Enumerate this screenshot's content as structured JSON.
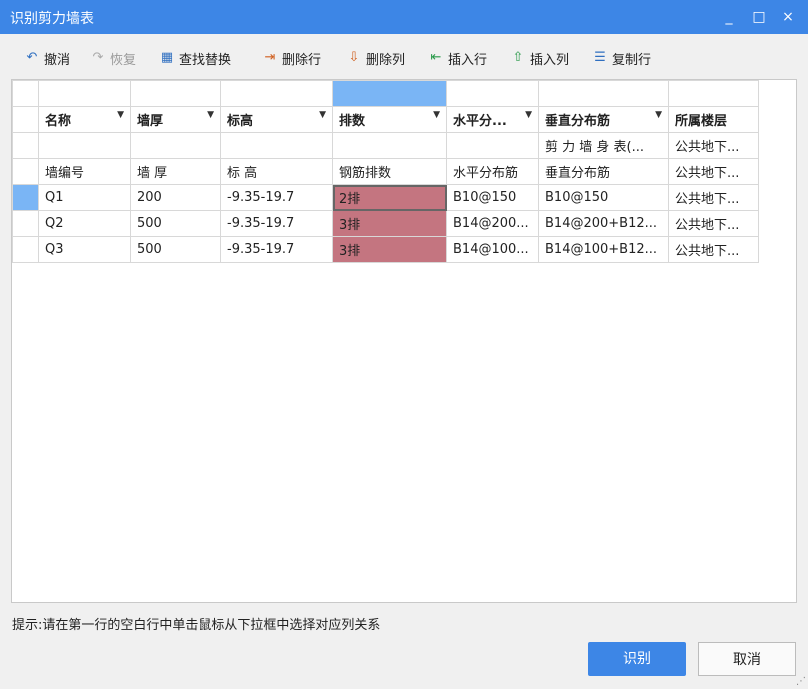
{
  "window": {
    "title": "识别剪力墙表",
    "minimize": "_",
    "maximize": "□",
    "close": "×"
  },
  "toolbar": {
    "undo": "撤消",
    "redo": "恢复",
    "find_replace": "查找替换",
    "delete_row": "删除行",
    "delete_col": "删除列",
    "insert_row": "插入行",
    "insert_col": "插入列",
    "copy_row": "复制行"
  },
  "grid": {
    "headers": [
      "名称",
      "墙厚",
      "标高",
      "排数",
      "水平分...",
      "垂直分布筋",
      "所属楼层"
    ],
    "header_has_dropdown": [
      true,
      true,
      true,
      true,
      true,
      true,
      false
    ],
    "rows": [
      [
        "",
        "",
        "",
        "",
        "",
        "剪 力 墙 身 表(...",
        "公共地下..."
      ],
      [
        "墙编号",
        "墙 厚",
        "标 高",
        "钢筋排数",
        "水平分布筋",
        "垂直分布筋",
        "公共地下..."
      ],
      [
        "Q1",
        "200",
        "-9.35-19.7",
        "2排",
        "B10@150",
        "B10@150",
        "公共地下..."
      ],
      [
        "Q2",
        "500",
        "-9.35-19.7",
        "3排",
        "B14@200...",
        "B14@200+B12...",
        "公共地下..."
      ],
      [
        "Q3",
        "500",
        "-9.35-19.7",
        "3排",
        "B14@100...",
        "B14@100+B12...",
        "公共地下..."
      ]
    ]
  },
  "hint": "提示:请在第一行的空白行中单击鼠标从下拉框中选择对应列关系",
  "buttons": {
    "recognize": "识别",
    "cancel": "取消"
  },
  "colors": {
    "titlebar": "#3d86e6",
    "selection": "#7ab5f5",
    "highlight_cell": "#c47580"
  }
}
